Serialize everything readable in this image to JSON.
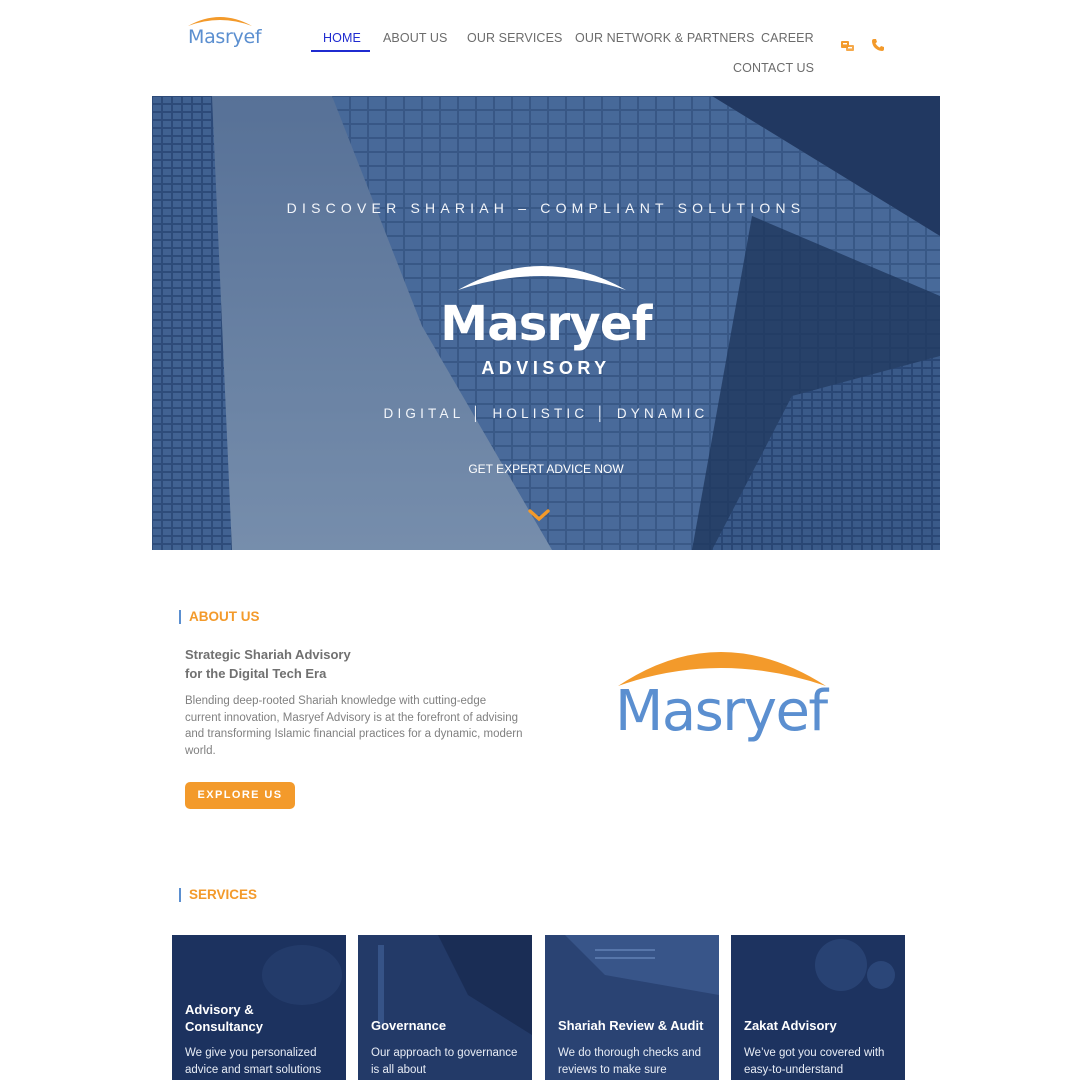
{
  "header": {
    "logo_text": "Masryef",
    "nav": [
      {
        "label": "HOME",
        "active": true
      },
      {
        "label": "ABOUT US"
      },
      {
        "label": "OUR SERVICES"
      },
      {
        "label": "OUR NETWORK & PARTNERS"
      },
      {
        "label": "CAREER"
      },
      {
        "label": "CONTACT US"
      }
    ],
    "icons": [
      "translate-icon",
      "phone-icon"
    ]
  },
  "hero": {
    "tagline": "DISCOVER SHARIAH – COMPLIANT SOLUTIONS",
    "brand": "Masryef",
    "brand_sub": "ADVISORY",
    "pillars": "DIGITAL  │  HOLISTIC  │  DYNAMIC",
    "cta": "GET EXPERT ADVICE NOW"
  },
  "about": {
    "heading": "ABOUT US",
    "title_line1": "Strategic Shariah Advisory",
    "title_line2": "for the Digital Tech Era",
    "body": "Blending deep-rooted Shariah knowledge with cutting-edge current innovation, Masryef Advisory is at the forefront of advising and transforming Islamic financial practices for a dynamic, modern world.",
    "button": "EXPLORE US",
    "logo_text": "Masryef"
  },
  "services": {
    "heading": "SERVICES",
    "cards": [
      {
        "title": "Advisory & Consultancy",
        "desc": "We give you personalized advice and smart solutions"
      },
      {
        "title": "Governance",
        "desc": "Our approach to governance is all about"
      },
      {
        "title": "Shariah Review & Audit",
        "desc": "We do thorough checks and reviews to make sure"
      },
      {
        "title": "Zakat Advisory",
        "desc": "We’ve got you covered with easy-to-understand"
      }
    ]
  },
  "colors": {
    "accent_orange": "#f39a2b",
    "brand_blue": "#5b8fd0",
    "nav_active": "#1f2bd0",
    "card_navy": "#1f3560"
  }
}
